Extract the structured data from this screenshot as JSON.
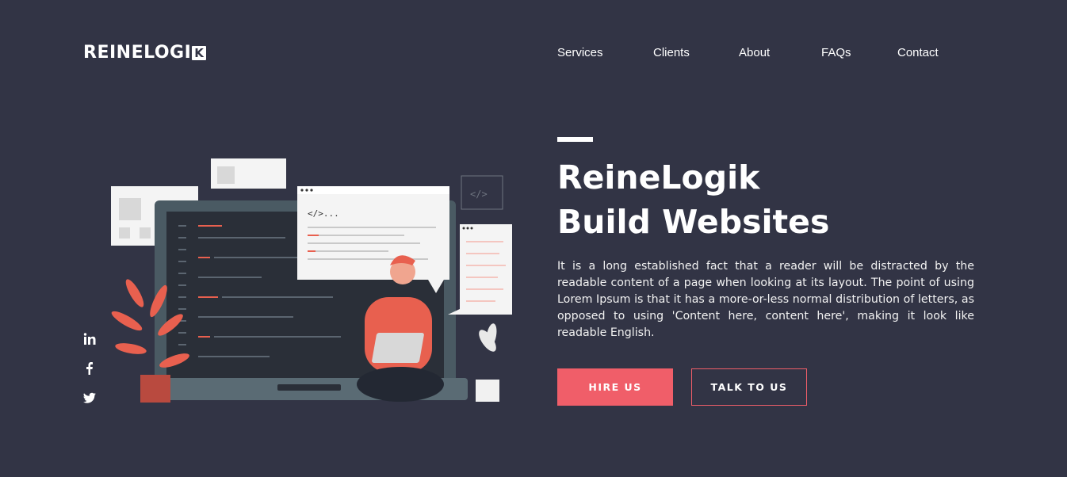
{
  "brand": {
    "logo_text": "REINELOGI",
    "logo_box": "K"
  },
  "nav": {
    "items": [
      "Services",
      "Clients",
      "About",
      "FAQs",
      "Contact"
    ]
  },
  "hero": {
    "title_line1": "ReineLogik",
    "title_line2": "Build Websites",
    "description": "It is a long established fact that a reader will be distracted by the readable content of a page when looking at its layout. The point of using Lorem Ipsum is that it has a more-or-less normal distribution of letters, as opposed to using 'Content here, content here', making it look like readable English.",
    "hire_label": "HIRE US",
    "talk_label": "TALK TO US"
  },
  "illustration": {
    "code_snippet": "</>..."
  },
  "social": [
    "linkedin-icon",
    "facebook-icon",
    "twitter-icon"
  ],
  "colors": {
    "background": "#323445",
    "accent": "#f05e69",
    "text": "#ffffff"
  }
}
